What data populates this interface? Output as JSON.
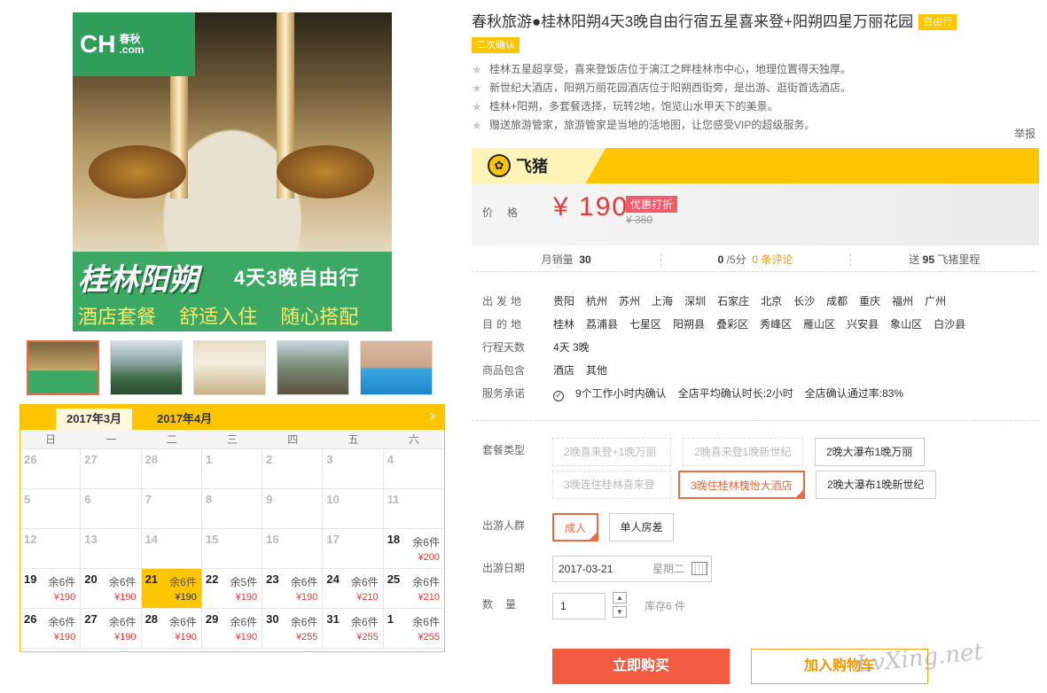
{
  "gallery": {
    "logo_text": "CH",
    "logo_sub_top": "春秋",
    "logo_sub_bottom": ".com",
    "banner_title": "桂林阳朔",
    "banner_sub": "4天3晚自由行",
    "banner_slogan": "酒店套餐 舒适入住 随心搭配"
  },
  "calendar": {
    "months": [
      "2017年3月",
      "2017年4月"
    ],
    "weekdays": [
      "日",
      "一",
      "二",
      "三",
      "四",
      "五",
      "六"
    ],
    "days": [
      {
        "d": "26"
      },
      {
        "d": "27"
      },
      {
        "d": "28"
      },
      {
        "d": "1"
      },
      {
        "d": "2"
      },
      {
        "d": "3"
      },
      {
        "d": "4"
      },
      {
        "d": "5"
      },
      {
        "d": "6"
      },
      {
        "d": "7"
      },
      {
        "d": "8"
      },
      {
        "d": "9"
      },
      {
        "d": "10"
      },
      {
        "d": "11"
      },
      {
        "d": "12"
      },
      {
        "d": "13"
      },
      {
        "d": "14"
      },
      {
        "d": "15"
      },
      {
        "d": "16"
      },
      {
        "d": "17"
      },
      {
        "d": "18",
        "stock": "余6件",
        "price": "¥200"
      },
      {
        "d": "19",
        "stock": "余6件",
        "price": "¥190"
      },
      {
        "d": "20",
        "stock": "余6件",
        "price": "¥190"
      },
      {
        "d": "21",
        "stock": "余6件",
        "price": "¥190",
        "selected": true
      },
      {
        "d": "22",
        "stock": "余5件",
        "price": "¥190"
      },
      {
        "d": "23",
        "stock": "余6件",
        "price": "¥190"
      },
      {
        "d": "24",
        "stock": "余6件",
        "price": "¥210"
      },
      {
        "d": "25",
        "stock": "余6件",
        "price": "¥210"
      },
      {
        "d": "26",
        "stock": "余6件",
        "price": "¥190"
      },
      {
        "d": "27",
        "stock": "余6件",
        "price": "¥190"
      },
      {
        "d": "28",
        "stock": "余6件",
        "price": "¥190"
      },
      {
        "d": "29",
        "stock": "余6件",
        "price": "¥190"
      },
      {
        "d": "30",
        "stock": "余6件",
        "price": "¥255"
      },
      {
        "d": "31",
        "stock": "余6件",
        "price": "¥255"
      },
      {
        "d": "1",
        "stock": "余6件",
        "price": "¥255"
      }
    ]
  },
  "product": {
    "title": "春秋旅游●桂林阳朔4天3晚自由行宿五星喜来登+阳朔四星万丽花园",
    "tag_type": "自由行",
    "tag_confirm": "二次确认",
    "features": [
      "桂林五星超享受，喜来登饭店位于漓江之畔桂林市中心，地理位置得天独厚。",
      "新世纪大酒店，阳朔万丽花园酒店位于阳朔西街旁，是出游、逛街首选酒店。",
      "桂林+阳朔，多套餐选择，玩转2地，饱览山水甲天下的美景。",
      "赠送旅游管家，旅游管家是当地的活地图，让您感受VIP的超级服务。"
    ],
    "report": "举报"
  },
  "fliggy": {
    "brand": "飞猪",
    "icon": "pig-icon"
  },
  "pricing": {
    "label": "价格",
    "price": "¥ 190",
    "discount_badge": "优惠打折",
    "original_price": "¥ 380"
  },
  "stats": {
    "monthly_label": "月销量",
    "monthly_value": "30",
    "score_value": "0",
    "score_suffix": "/5分",
    "reviews": "0 条评论",
    "miles_prefix": "送",
    "miles_value": "95",
    "miles_suffix": "飞猪里程"
  },
  "info": {
    "departure_label": "出发地",
    "departures": [
      "贵阳",
      "杭州",
      "苏州",
      "上海",
      "深圳",
      "石家庄",
      "北京",
      "长沙",
      "成都",
      "重庆",
      "福州",
      "广州"
    ],
    "destination_label": "目的地",
    "destinations": [
      "桂林",
      "荔浦县",
      "七星区",
      "阳朔县",
      "叠彩区",
      "秀峰区",
      "雁山区",
      "兴安县",
      "象山区",
      "白沙县"
    ],
    "days_label": "行程天数",
    "days_value": "4天 3晚",
    "includes_label": "商品包含",
    "includes": [
      "酒店",
      "其他"
    ],
    "service_label": "服务承诺",
    "service_items": [
      "9个工作小时内确认",
      "全店平均确认时长:2小时",
      "全店确认通过率:83%"
    ]
  },
  "options": {
    "package_label": "套餐类型",
    "packages": [
      "2晚喜来登+1晚万丽",
      "2晚喜来登1晚新世纪",
      "2晚大瀑布1晚万丽",
      "3晚连住桂林喜来登",
      "3晚住桂林槐怡大酒店",
      "2晚大瀑布1晚新世纪"
    ],
    "traveler_label": "出游人群",
    "travelers": [
      "成人",
      "单人房差"
    ],
    "date_label": "出游日期",
    "date_value": "2017-03-21",
    "date_weekday": "星期二",
    "qty_label": "数量",
    "qty_value": "1",
    "stock_text": "库存6 件"
  },
  "actions": {
    "buy": "立即购买",
    "cart": "加入购物车"
  },
  "watermark": "LvXing.net"
}
